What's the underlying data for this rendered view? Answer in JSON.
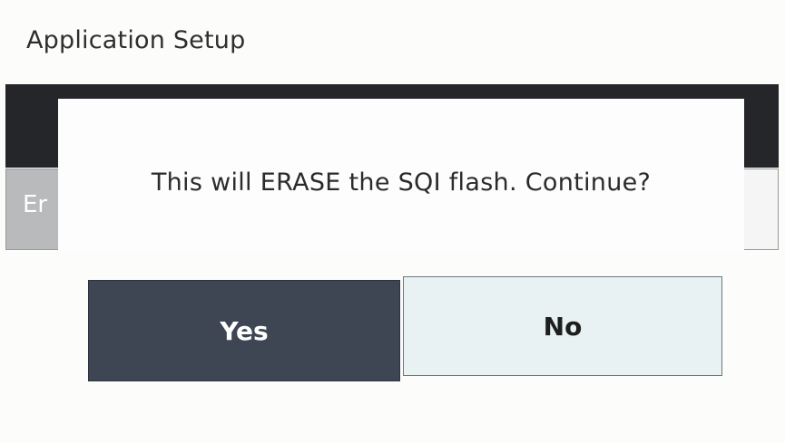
{
  "header": {
    "title": "Application Setup"
  },
  "background": {
    "erase_tile_label": "Er"
  },
  "dialog": {
    "message": "This will ERASE the SQI flash. Continue?",
    "yes_label": "Yes",
    "no_label": "No"
  },
  "colors": {
    "title_bar": "#25262a",
    "yes_button": "#3e4553",
    "no_button": "#e9f2f3"
  }
}
